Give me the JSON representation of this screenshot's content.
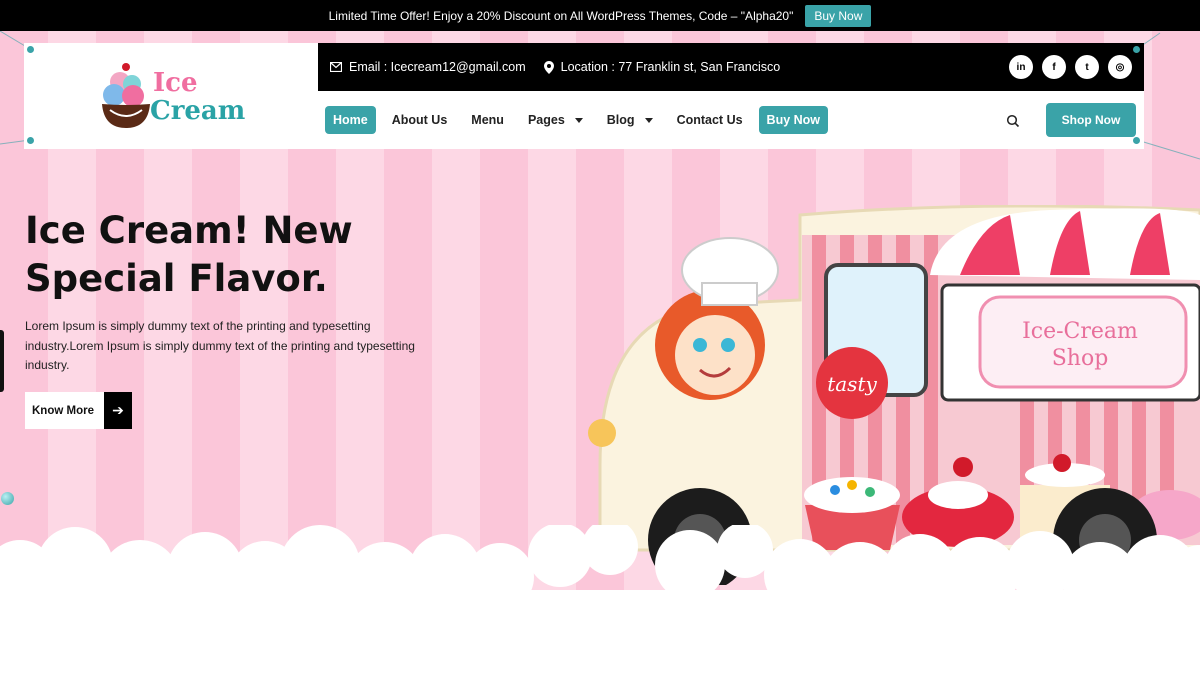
{
  "topbar": {
    "message": "Limited Time Offer! Enjoy a 20% Discount on All WordPress Themes, Code – \"Alpha20\"",
    "button_label": "Buy Now"
  },
  "logo": {
    "line1": "Ice",
    "line2": "Cream"
  },
  "contact": {
    "email": "Email : Icecream12@gmail.com",
    "location": "Location : 77 Franklin st, San Francisco"
  },
  "socials": [
    {
      "icon": "linkedin-icon",
      "glyph": "in"
    },
    {
      "icon": "facebook-icon",
      "glyph": "f"
    },
    {
      "icon": "twitter-icon",
      "glyph": "t"
    },
    {
      "icon": "instagram-icon",
      "glyph": "◎"
    }
  ],
  "nav": {
    "items": [
      {
        "label": "Home"
      },
      {
        "label": "About Us"
      },
      {
        "label": "Menu"
      },
      {
        "label": "Pages"
      },
      {
        "label": "Blog"
      },
      {
        "label": "Contact Us"
      },
      {
        "label": "Buy Now"
      }
    ],
    "shop_label": "Shop Now"
  },
  "hero": {
    "title": "Ice Cream! New Special Flavor.",
    "description": "Lorem Ipsum is simply dummy text of the printing and typesetting industry.Lorem Ipsum is simply dummy text of the printing and typesetting industry.",
    "button_label": "Know More"
  },
  "illustration": {
    "sign_line1": "Ice-Cream",
    "sign_line2": "Shop",
    "bubble_text": "tasty"
  },
  "colors": {
    "accent": "#3aa3a8",
    "pink": "#f06ea0",
    "stripe_light": "#fdd8e5",
    "stripe_dark": "#fbc6d9"
  }
}
